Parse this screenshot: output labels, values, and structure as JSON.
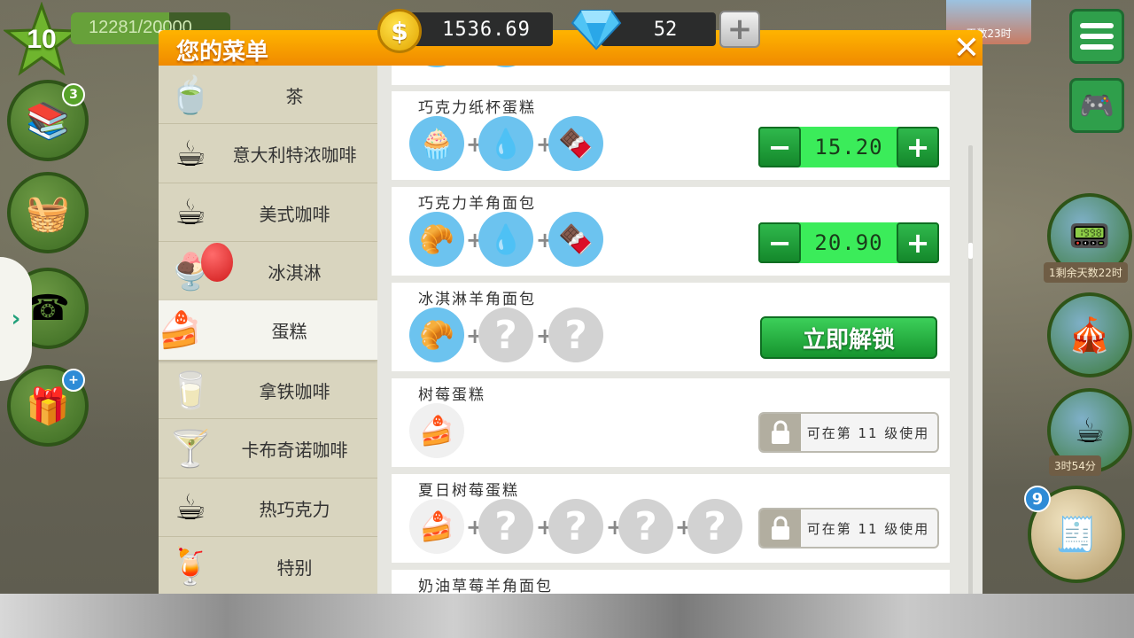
{
  "hud": {
    "level": "10",
    "xp_text": "12281/20000",
    "xp_progress": 0.614,
    "coins": "1536.69",
    "gems": "52",
    "coin_symbol": "$",
    "gem_add_label": "+",
    "inventory_badge": "3",
    "gift_badge": "+",
    "register_badge": "9",
    "banner_timer": "天数23时",
    "right_tag_1": "1剩余天数22时",
    "right_tag_2": "3时54分"
  },
  "dialog": {
    "title": "您的菜单",
    "close_label": "✕"
  },
  "categories": [
    {
      "label": "茶",
      "icon": "tea-cup-icon",
      "glyph": "🍵"
    },
    {
      "label": "意大利特浓咖啡",
      "icon": "espresso-cup-icon",
      "glyph": "☕"
    },
    {
      "label": "美式咖啡",
      "icon": "americano-cup-icon",
      "glyph": "☕"
    },
    {
      "label": "冰淇淋",
      "icon": "ice-cream-icon",
      "glyph": "🍨"
    },
    {
      "label": "蛋糕",
      "icon": "cake-icon",
      "glyph": "🍰"
    },
    {
      "label": "拿铁咖啡",
      "icon": "latte-glass-icon",
      "glyph": "🥛"
    },
    {
      "label": "卡布奇诺咖啡",
      "icon": "cappuccino-glass-icon",
      "glyph": "🍸"
    },
    {
      "label": "热巧克力",
      "icon": "hot-chocolate-icon",
      "glyph": "☕"
    },
    {
      "label": "特别",
      "icon": "special-drink-icon",
      "glyph": "🍹"
    }
  ],
  "active_category": "蛋糕",
  "recipes": [
    {
      "name": "巧克力纸杯蛋糕",
      "ingredients": [
        {
          "icon": "cupcake-icon",
          "glyph": "🧁"
        },
        {
          "icon": "chocolate-drop-icon",
          "glyph": "💧"
        },
        {
          "icon": "chocolate-bar-icon",
          "glyph": "🍫"
        }
      ],
      "price": "15.20",
      "minus_label": "−",
      "plus_label": "+"
    },
    {
      "name": "巧克力羊角面包",
      "ingredients": [
        {
          "icon": "croissant-icon",
          "glyph": "🥐"
        },
        {
          "icon": "chocolate-drop-icon",
          "glyph": "💧"
        },
        {
          "icon": "chocolate-bar-icon",
          "glyph": "🍫"
        }
      ],
      "price": "20.90",
      "minus_label": "−",
      "plus_label": "+"
    },
    {
      "name": "冰淇淋羊角面包",
      "ingredients": [
        {
          "icon": "croissant-icon",
          "glyph": "🥐"
        },
        {
          "icon": "unknown-ingredient-icon",
          "glyph": "?"
        },
        {
          "icon": "unknown-ingredient-icon",
          "glyph": "?"
        }
      ],
      "unlock_label": "立即解锁"
    },
    {
      "name": "树莓蛋糕",
      "ingredients": [
        {
          "icon": "raspberry-cake-icon",
          "glyph": "🍰"
        }
      ],
      "lock_text": "可在第 11 级使用"
    },
    {
      "name": "夏日树莓蛋糕",
      "ingredients": [
        {
          "icon": "raspberry-cake-icon",
          "glyph": "🍰"
        },
        {
          "icon": "unknown-ingredient-icon",
          "glyph": "?"
        },
        {
          "icon": "unknown-ingredient-icon",
          "glyph": "?"
        },
        {
          "icon": "unknown-ingredient-icon",
          "glyph": "?"
        },
        {
          "icon": "unknown-ingredient-icon",
          "glyph": "?"
        }
      ],
      "lock_text": "可在第 11 级使用"
    },
    {
      "name": "奶油草莓羊角面包"
    }
  ],
  "colors": {
    "header_orange": "#f5a000",
    "price_green": "#3bec5a",
    "button_green": "#16942e",
    "ingredient_blue": "#6cc3ef",
    "category_bg": "#d9d5bf"
  }
}
